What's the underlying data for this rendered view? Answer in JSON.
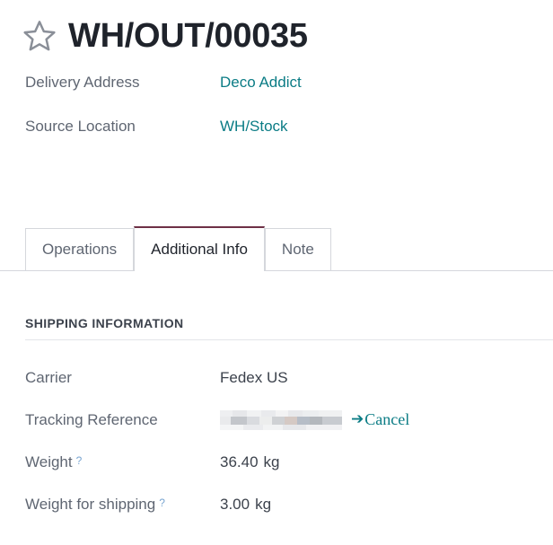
{
  "header": {
    "star_icon": "star-outline-icon",
    "title": "WH/OUT/00035"
  },
  "header_fields": [
    {
      "label": "Delivery Address",
      "value": "Deco Addict",
      "is_link": true
    },
    {
      "label": "Source Location",
      "value": "WH/Stock",
      "is_link": true
    }
  ],
  "tabs": [
    {
      "label": "Operations",
      "active": false
    },
    {
      "label": "Additional Info",
      "active": true
    },
    {
      "label": "Note",
      "active": false
    }
  ],
  "section": {
    "title": "SHIPPING INFORMATION",
    "rows": {
      "carrier": {
        "label": "Carrier",
        "value": "Fedex US"
      },
      "tracking_reference": {
        "label": "Tracking Reference",
        "value": "",
        "value_state": "redacted",
        "action_icon": "➔",
        "action_label": "Cancel"
      },
      "weight": {
        "label": "Weight",
        "help": "?",
        "value": "36.40",
        "unit": "kg"
      },
      "weight_for_shipping": {
        "label": "Weight for shipping",
        "help": "?",
        "value": "3.00",
        "unit": "kg"
      }
    }
  },
  "colors": {
    "link_teal": "#0b7c85",
    "active_tab_border": "#6e3046",
    "label_gray": "#5f6672",
    "value_dark": "#3c424c",
    "help_blue": "#79a5d1"
  }
}
